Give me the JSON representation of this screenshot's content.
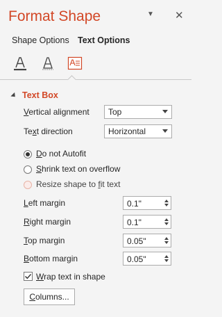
{
  "pane": {
    "title": "Format Shape",
    "dropdown_glyph": "▼",
    "close_glyph": "✕"
  },
  "tabs": [
    {
      "label": "Shape Options"
    },
    {
      "label": "Text Options"
    }
  ],
  "icons": [
    "text-fill-icon",
    "text-effects-icon",
    "textbox-icon"
  ],
  "section": {
    "title": "Text Box",
    "vertical_alignment": {
      "label_pre": "",
      "label_ul": "V",
      "label_post": "ertical alignment",
      "value": "Top"
    },
    "text_direction": {
      "label_pre": "Te",
      "label_ul": "x",
      "label_post": "t direction",
      "value": "Horizontal"
    },
    "autofit": [
      {
        "pre": "",
        "ul": "D",
        "post": "o not Autofit",
        "selected": true
      },
      {
        "pre": "",
        "ul": "S",
        "post": "hrink text on overflow",
        "selected": false
      },
      {
        "pre": "Resize shape to ",
        "ul": "f",
        "post": "it text",
        "selected": false
      }
    ],
    "margins": [
      {
        "pre": "",
        "ul": "L",
        "post": "eft margin",
        "value": "0.1\""
      },
      {
        "pre": "",
        "ul": "R",
        "post": "ight margin",
        "value": "0.1\""
      },
      {
        "pre": "",
        "ul": "T",
        "post": "op margin",
        "value": "0.05\""
      },
      {
        "pre": "",
        "ul": "B",
        "post": "ottom margin",
        "value": "0.05\""
      }
    ],
    "wrap": {
      "pre": "",
      "ul": "W",
      "post": "rap text in shape",
      "checked": true
    },
    "columns_button": {
      "pre": "",
      "ul": "C",
      "post": "olumns..."
    }
  },
  "colors": {
    "accent": "#d24726"
  }
}
